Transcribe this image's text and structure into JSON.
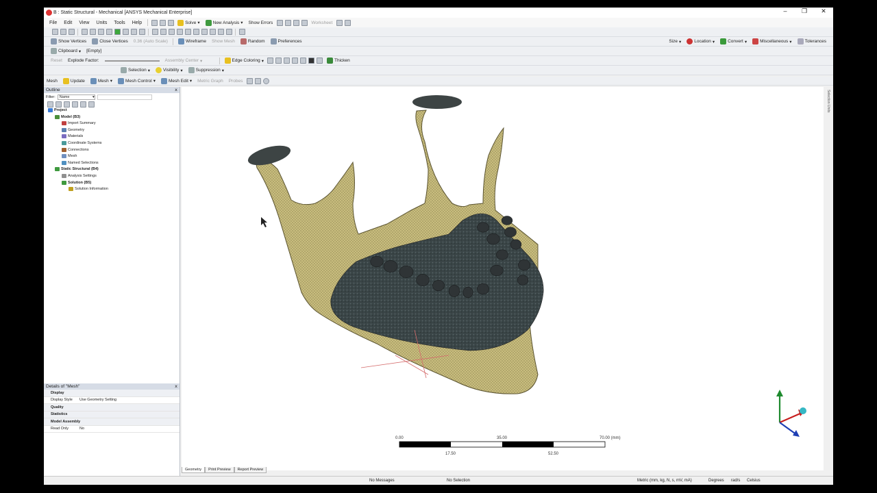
{
  "window": {
    "title": "B : Static Structural - Mechanical [ANSYS Mechanical Enterprise]",
    "controls": [
      "–",
      "❐",
      "✕"
    ]
  },
  "menu": [
    "File",
    "Edit",
    "View",
    "Units",
    "Tools",
    "Help"
  ],
  "toolbar1": [
    "Solve",
    "New Analysis",
    "Show Errors",
    "Worksheet"
  ],
  "toolbar3": {
    "show_vertices": "Show Vertices",
    "close_vertices": "Close Vertices",
    "auto_scale": "0.36 (Auto Scale)",
    "wireframe": "Wireframe",
    "show_mesh": "Show Mesh",
    "random": "Random",
    "preferences": "Preferences",
    "size": "Size",
    "location": "Location",
    "convert": "Convert",
    "misc": "Miscellaneous",
    "tolerances": "Tolerances"
  },
  "toolbar4": {
    "clipboard": "Clipboard",
    "empty": "[Empty]"
  },
  "toolbar5": {
    "reset": "Reset",
    "explode": "Explode Factor:",
    "assembly_center": "Assembly Center",
    "edge_coloring": "Edge Coloring",
    "thicken": "Thicken"
  },
  "toolbar6": {
    "selection": "Selection",
    "visibility": "Visibility",
    "suppression": "Suppression"
  },
  "toolbar7": {
    "mesh": "Mesh",
    "update": "Update",
    "mesh_dd": "Mesh",
    "mesh_control": "Mesh Control",
    "mesh_edit": "Mesh Edit",
    "metric_graph": "Metric Graph",
    "probes": "Probes"
  },
  "outline": {
    "title": "Outline",
    "filter_label": "Filter:",
    "filter_value": "Name",
    "tree": [
      {
        "label": "Project",
        "lvl": 0,
        "bold": true,
        "color": "#3a7bd5"
      },
      {
        "label": "Model (B3)",
        "lvl": 1,
        "bold": true,
        "color": "#4b8f3a"
      },
      {
        "label": "Import Summary",
        "lvl": 2,
        "color": "#c04040"
      },
      {
        "label": "Geometry",
        "lvl": 2,
        "color": "#5b7fb0"
      },
      {
        "label": "Materials",
        "lvl": 2,
        "color": "#7a6cc0"
      },
      {
        "label": "Coordinate Systems",
        "lvl": 2,
        "color": "#4a9a9a"
      },
      {
        "label": "Connections",
        "lvl": 2,
        "color": "#a06030"
      },
      {
        "label": "Mesh",
        "lvl": 2,
        "color": "#7090c0"
      },
      {
        "label": "Named Selections",
        "lvl": 2,
        "color": "#5090c0"
      },
      {
        "label": "Static Structural (B4)",
        "lvl": 1,
        "bold": true,
        "color": "#3f9a3f"
      },
      {
        "label": "Analysis Settings",
        "lvl": 2,
        "color": "#909090"
      },
      {
        "label": "Solution (B5)",
        "lvl": 2,
        "bold": true,
        "color": "#3f9a3f"
      },
      {
        "label": "Solution Information",
        "lvl": 3,
        "color": "#c0a020"
      }
    ]
  },
  "details": {
    "title": "Details of \"Mesh\"",
    "rows": [
      {
        "k": "Display",
        "sec": true
      },
      {
        "k": "Display Style",
        "v": "Use Geometry Setting"
      },
      {
        "k": "Quality",
        "sec": true
      },
      {
        "k": "Statistics",
        "sec": true
      },
      {
        "k": "Model Assembly",
        "sec": true
      },
      {
        "k": "Read Only",
        "v": "No"
      }
    ]
  },
  "scale": {
    "t0": "0.00",
    "t1": "35.00",
    "t2": "70.00 (mm)",
    "b1": "17.50",
    "b2": "52.50"
  },
  "side_tab": "Selection Units",
  "tabs": [
    "Geometry",
    "Print Preview",
    "Report Preview"
  ],
  "status": {
    "messages": "No Messages",
    "selection": "No Selection",
    "units": "Metric (mm, kg, N, s, mV, mA)",
    "degrees": "Degrees",
    "rads": "rad/s",
    "temp": "Celsius"
  },
  "colors": {
    "bone": "#c9bd7e",
    "dark_mesh": "#3a4547",
    "tooth": "#2f3436",
    "axis_x": "#c81e1e",
    "axis_y": "#1e8a2e",
    "axis_z": "#1e3fb4"
  }
}
